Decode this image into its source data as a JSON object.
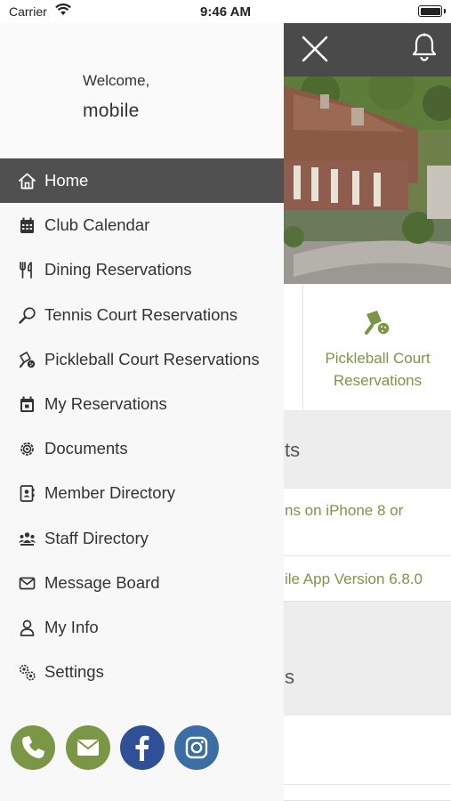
{
  "status_bar": {
    "carrier": "Carrier",
    "time": "9:46 AM"
  },
  "drawer": {
    "welcome": "Welcome,",
    "username": "mobile",
    "items": [
      {
        "label": "Home",
        "icon": "home-icon",
        "active": true
      },
      {
        "label": "Club Calendar",
        "icon": "calendar-icon"
      },
      {
        "label": "Dining Reservations",
        "icon": "fork-knife-icon"
      },
      {
        "label": "Tennis Court Reservations",
        "icon": "tennis-racket-icon"
      },
      {
        "label": "Pickleball Court Reservations",
        "icon": "pickleball-icon"
      },
      {
        "label": "My Reservations",
        "icon": "calendar-check-icon"
      },
      {
        "label": "Documents",
        "icon": "document-gear-icon"
      },
      {
        "label": "Member Directory",
        "icon": "contact-book-icon"
      },
      {
        "label": "Staff Directory",
        "icon": "staff-group-icon"
      },
      {
        "label": "Message Board",
        "icon": "envelope-icon"
      },
      {
        "label": "My Info",
        "icon": "user-icon"
      },
      {
        "label": "Settings",
        "icon": "gears-icon"
      }
    ],
    "socials": [
      {
        "name": "phone-icon",
        "color": "#7b9645"
      },
      {
        "name": "email-icon",
        "color": "#7b9645"
      },
      {
        "name": "facebook-icon",
        "color": "#2f4f96"
      },
      {
        "name": "instagram-icon",
        "color": "#3a6ea5"
      }
    ]
  },
  "background": {
    "header_color": "#4a4a4a",
    "quick_link": "Pickleball Court Reservations",
    "section1_title_fragment": "ts",
    "news1_fragment": "ns on iPhone 8 or",
    "news2_fragment": "ile App Version 6.8.0",
    "section2_title_fragment": "s",
    "accent_color": "#7b9645"
  }
}
